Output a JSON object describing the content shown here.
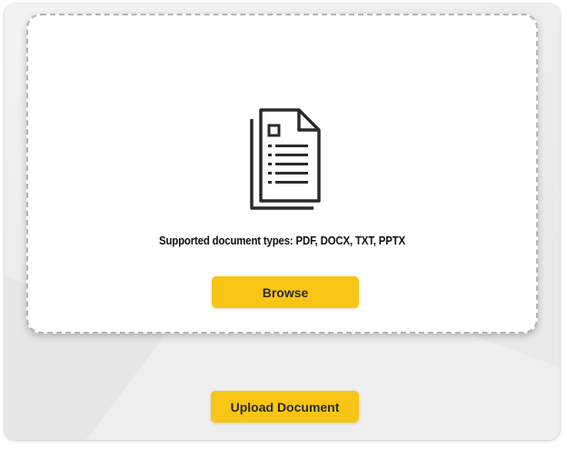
{
  "dropzone": {
    "icon": "document-icon",
    "supported_text": "Supported document types: PDF, DOCX, TXT, PPTX",
    "browse_label": "Browse"
  },
  "actions": {
    "upload_label": "Upload Document"
  },
  "colors": {
    "accent": "#f8c516",
    "panel_bg": "#ececec",
    "dropzone_border": "#b4b4b4"
  }
}
